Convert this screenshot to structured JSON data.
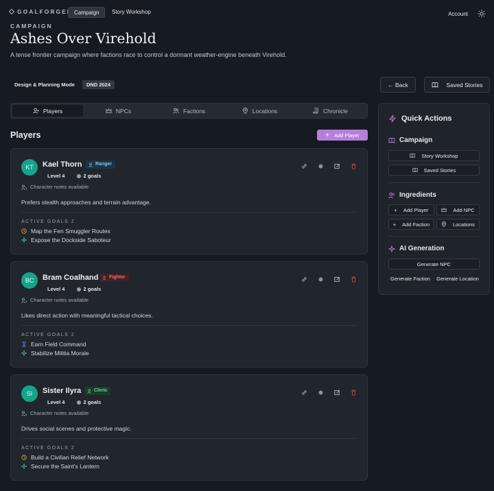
{
  "app": {
    "brand": "GOALFORGER",
    "nav": [
      "Campaign",
      "Story Workshop"
    ],
    "account": "Account"
  },
  "campaign": {
    "eyebrow": "CAMPAIGN",
    "title": "Ashes Over Virehold",
    "description": "A tense frontier campaign where factions race to control a dormant weather-engine beneath Virehold.",
    "mode": "Design & Planning Mode",
    "edition": "DND 2024"
  },
  "toolbar": {
    "back": "← Back",
    "saved_stories": "Saved Stories"
  },
  "tabs": [
    "Players",
    "NPCs",
    "Factions",
    "Locations",
    "Chronicle"
  ],
  "players_section": {
    "title": "Players",
    "add_label": "Add Player"
  },
  "players": [
    {
      "initials": "KT",
      "name": "Kael Thorn",
      "class": "Ranger",
      "level": "Level 4",
      "goals_count": "2 goals",
      "notes": "Character notes available",
      "description": "Prefers stealth approaches and terrain advantage.",
      "goals_header": "ACTIVE GOALS  2",
      "goals": [
        "Map the Fen Smuggler Routes",
        "Expose the Dockside Saboteur"
      ]
    },
    {
      "initials": "BC",
      "name": "Bram Coalhand",
      "class": "Fighter",
      "level": "Level 4",
      "goals_count": "2 goals",
      "notes": "Character notes available",
      "description": "Likes direct action with meaningful tactical choices.",
      "goals_header": "ACTIVE GOALS  2",
      "goals": [
        "Earn Field Command",
        "Stabilize Militia Morale"
      ]
    },
    {
      "initials": "SI",
      "name": "Sister Ilyra",
      "class": "Cleric",
      "level": "Level 4",
      "goals_count": "2 goals",
      "notes": "Character notes available",
      "description": "Drives social scenes and protective magic.",
      "goals_header": "ACTIVE GOALS  2",
      "goals": [
        "Build a Civilian Relief Network",
        "Secure the Saint's Lantern"
      ]
    }
  ],
  "quick_actions": {
    "title": "Quick Actions",
    "campaign": {
      "heading": "Campaign",
      "story_workshop": "Story Workshop",
      "saved_stories": "Saved Stories"
    },
    "ingredients": {
      "heading": "Ingredients",
      "add_player": "Add Player",
      "add_npc": "Add NPC",
      "add_faction": "Add Faction",
      "locations": "Locations"
    },
    "ai": {
      "heading": "AI Generation",
      "generate_npc": "Generate NPC",
      "generate_faction": "Generate Faction",
      "generate_location": "Generate Location"
    }
  },
  "colors": {
    "accent_purple": "#b67fd9",
    "avatar_teal": "#14a38b",
    "ranger": "#5cb8e6",
    "fighter": "#e05a5a",
    "cleric": "#4cd08a"
  }
}
